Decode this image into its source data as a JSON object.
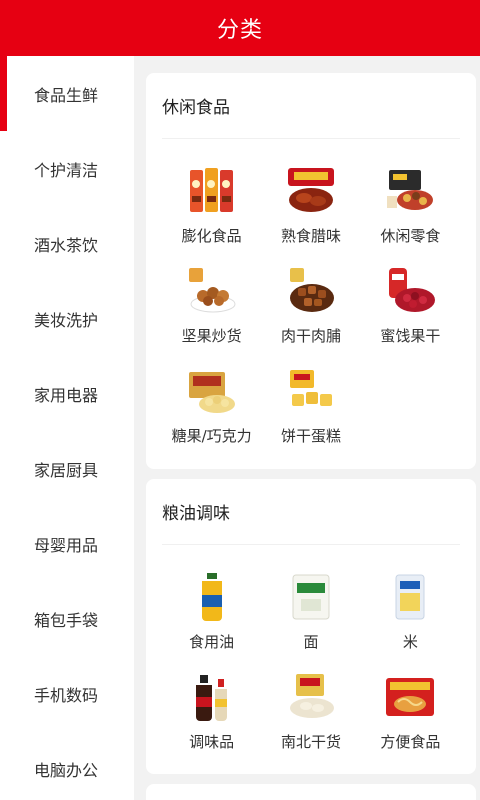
{
  "header": {
    "title": "分类"
  },
  "sidebar": {
    "items": [
      {
        "label": "食品生鲜"
      },
      {
        "label": "个护清洁"
      },
      {
        "label": "酒水茶饮"
      },
      {
        "label": "美妆洗护"
      },
      {
        "label": "家用电器"
      },
      {
        "label": "家居厨具"
      },
      {
        "label": "母婴用品"
      },
      {
        "label": "箱包手袋"
      },
      {
        "label": "手机数码"
      },
      {
        "label": "电脑办公"
      }
    ]
  },
  "sections": [
    {
      "title": "休闲食品",
      "items": [
        {
          "label": "膨化食品",
          "icon": "chips-bags-icon"
        },
        {
          "label": "熟食腊味",
          "icon": "cured-meat-icon"
        },
        {
          "label": "休闲零食",
          "icon": "snack-box-icon"
        },
        {
          "label": "坚果炒货",
          "icon": "nuts-bowl-icon"
        },
        {
          "label": "肉干肉脯",
          "icon": "jerky-bowl-icon"
        },
        {
          "label": "蜜饯果干",
          "icon": "dried-fruit-icon"
        },
        {
          "label": "糖果/巧克力",
          "icon": "candy-box-icon"
        },
        {
          "label": "饼干蛋糕",
          "icon": "cake-icon"
        }
      ]
    },
    {
      "title": "粮油调味",
      "items": [
        {
          "label": "食用油",
          "icon": "cooking-oil-icon"
        },
        {
          "label": "面",
          "icon": "flour-bag-icon"
        },
        {
          "label": "米",
          "icon": "rice-bag-icon"
        },
        {
          "label": "调味品",
          "icon": "sauce-bottles-icon"
        },
        {
          "label": "南北干货",
          "icon": "dried-goods-icon"
        },
        {
          "label": "方便食品",
          "icon": "instant-noodles-icon"
        }
      ]
    }
  ],
  "colors": {
    "brand": "#e60012",
    "background": "#f2f2f2"
  }
}
